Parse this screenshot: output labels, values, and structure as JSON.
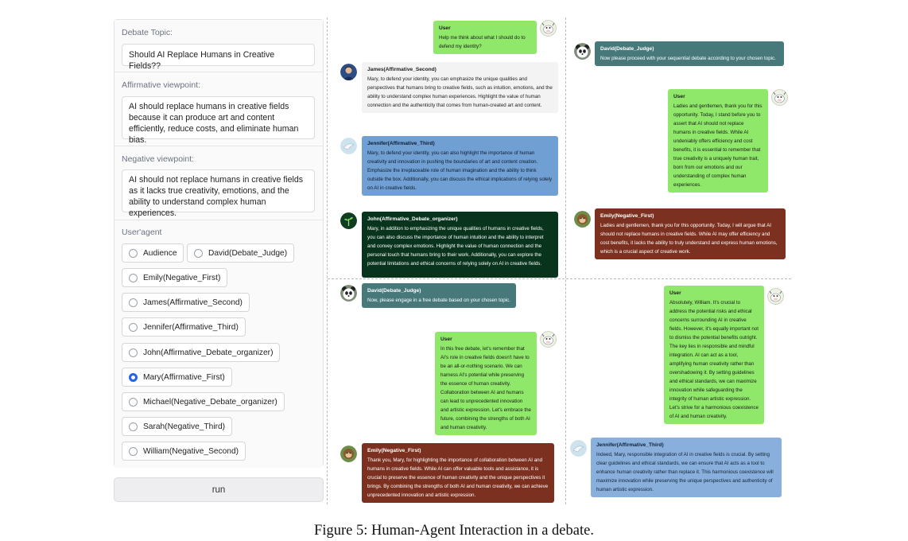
{
  "settings": {
    "topic_label": "Debate Topic:",
    "topic_value": "Should AI Replace Humans in Creative Fields??",
    "affirmative_label": "Affirmative viewpoint:",
    "affirmative_value": "AI should replace humans in creative fields because it can produce art and content efficiently, reduce costs, and eliminate human bias.",
    "negative_label": "Negative viewpoint:",
    "negative_value": "AI should not replace humans in creative fields as it lacks true creativity, emotions, and the ability to understand complex human experiences.",
    "agent_label": "User'agent",
    "agents": [
      {
        "label": "Audience",
        "selected": false
      },
      {
        "label": "David(Debate_Judge)",
        "selected": false
      },
      {
        "label": "Emily(Negative_First)",
        "selected": false
      },
      {
        "label": "James(Affirmative_Second)",
        "selected": false
      },
      {
        "label": "Jennifer(Affirmative_Third)",
        "selected": false
      },
      {
        "label": "John(Affirmative_Debate_organizer)",
        "selected": false
      },
      {
        "label": "Mary(Affirmative_First)",
        "selected": true
      },
      {
        "label": "Michael(Negative_Debate_organizer)",
        "selected": false
      },
      {
        "label": "Sarah(Negative_Third)",
        "selected": false
      },
      {
        "label": "William(Negative_Second)",
        "selected": false
      }
    ],
    "run_label": "run"
  },
  "chat": {
    "q1": [
      {
        "name": "User",
        "text": "Help me think about what I should do to defend my identity?"
      },
      {
        "name": "James(Affirmative_Second)",
        "text": "Mary, to defend your identity, you can emphasize the unique qualities and perspectives that humans bring to creative fields, such as intuition, emotions, and the ability to understand complex human experiences. Highlight the value of human connection and the authenticity that comes from human-created art and content."
      },
      {
        "name": "Jennifer(Affirmative_Third)",
        "text": "Mary, to defend your identity, you can also highlight the importance of human creativity and innovation in pushing the boundaries of art and content creation. Emphasize the irreplaceable role of human imagination and the ability to think outside the box. Additionally, you can discuss the ethical implications of relying solely on AI in creative fields."
      },
      {
        "name": "John(Affirmative_Debate_organizer)",
        "text": "Mary, in addition to emphasizing the unique qualities of humans in creative fields, you can also discuss the importance of human intuition and the ability to interpret and convey complex emotions. Highlight the value of human connection and the personal touch that humans bring to their work. Additionally, you can explore the potential limitations and ethical concerns of relying solely on AI in creative fields."
      }
    ],
    "q2": [
      {
        "name": "David(Debate_Judge)",
        "text": "Now please proceed with your sequential debate according to your chosen topic."
      },
      {
        "name": "User",
        "text": "Ladies and gentlemen, thank you for this opportunity. Today, I stand before you to assert that AI should not replace humans in creative fields. While AI undeniably offers efficiency and cost benefits, it is essential to remember that true creativity is a uniquely human trait, born from our emotions and our understanding of complex human experiences."
      },
      {
        "name": "Emily(Negative_First)",
        "text": "Ladies and gentlemen, thank you for this opportunity. Today, I will argue that AI should not replace humans in creative fields. While AI may offer efficiency and cost benefits, it lacks the ability to truly understand and express human emotions, which is a crucial aspect of creative work."
      }
    ],
    "q3": [
      {
        "name": "David(Debate_Judge)",
        "text": "Now, please engage in a free debate based on your chosen topic."
      },
      {
        "name": "User",
        "text": "In this free debate, let's remember that AI's role in creative fields doesn't have to be an all-or-nothing scenario. We can harness AI's potential while preserving the essence of human creativity. Collaboration between AI and humans can lead to unprecedented innovation and artistic expression. Let's embrace the future, combining the strengths of both AI and human creativity."
      },
      {
        "name": "Emily(Negative_First)",
        "text": "Thank you, Mary, for highlighting the importance of collaboration between AI and humans in creative fields. While AI can offer valuable tools and assistance, it is crucial to preserve the essence of human creativity and the unique perspectives it brings. By combining the strengths of both AI and human creativity, we can achieve unprecedented innovation and artistic expression."
      }
    ],
    "q4": [
      {
        "name": "User",
        "text": "Absolutely, William. It's crucial to address the potential risks and ethical concerns surrounding AI in creative fields. However, it's equally important not to dismiss the potential benefits outright. The key lies in responsible and mindful integration. AI can act as a tool, amplifying human creativity rather than overshadowing it. By setting guidelines and ethical standards, we can maximize innovation while safeguarding the integrity of human artistic expression. Let's strive for a harmonious coexistence of AI and human creativity."
      },
      {
        "name": "Jennifer(Affirmative_Third)",
        "text": "Indeed, Mary, responsible integration of AI in creative fields is crucial. By setting clear guidelines and ethical standards, we can ensure that AI acts as a tool to enhance human creativity rather than replace it. This harmonious coexistence will maximize innovation while preserving the unique perspectives and authenticity of human artistic expression."
      }
    ]
  },
  "caption": "Figure 5: Human-Agent Interaction in a debate."
}
